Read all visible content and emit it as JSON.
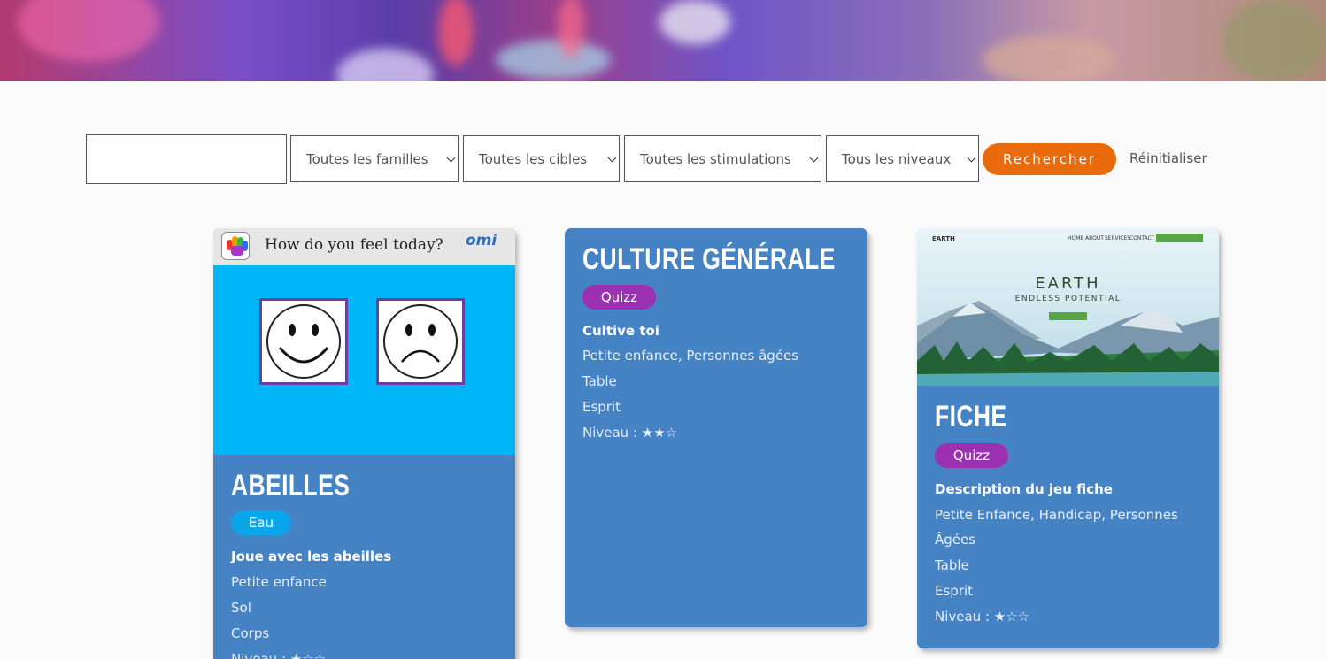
{
  "search": {
    "placeholder": ""
  },
  "filters": {
    "families": "Toutes les familles",
    "targets": "Toutes les cibles",
    "stimulations": "Toutes les stimulations",
    "levels": "Tous les niveaux"
  },
  "actions": {
    "search": "Rechercher",
    "reset": "Réinitialiser"
  },
  "colors": {
    "accent": "#ea6b0c",
    "card": "#4583c4",
    "tag_quizz": "#9b30b3",
    "tag_eau": "#0aa5ea"
  },
  "cards": [
    {
      "image": {
        "question": "How do you feel today?",
        "brand": "omi",
        "faces": [
          "happy-face-icon",
          "sad-face-icon"
        ]
      },
      "title": "Abeilles",
      "tag": "Eau",
      "description": "Joue avec les abeilles",
      "audience": "Petite enfance",
      "place": "Sol",
      "stimulation": "Corps",
      "level": "Niveau : ★☆☆",
      "level_value": 1,
      "level_max": 3
    },
    {
      "title": "Culture Générale",
      "tag": "Quizz",
      "description": "Cultive toi",
      "audience": "Petite enfance, Personnes âgées",
      "place": "Table",
      "stimulation": "Esprit",
      "level": "Niveau : ★★☆",
      "level_value": 2,
      "level_max": 3
    },
    {
      "image": {
        "logo": "EARTH",
        "nav": [
          "HOME",
          "ABOUT",
          "SERVICES",
          "CONTACT"
        ],
        "heading": "EARTH",
        "subheading": "ENDLESS POTENTIAL"
      },
      "title": "Fiche",
      "tag": "Quizz",
      "description": "Description du jeu fiche",
      "audience_line1": "Petite Enfance, Handicap, Personnes",
      "audience_line2": "Âgées",
      "place": "Table",
      "stimulation": "Esprit",
      "level": "Niveau : ★☆☆",
      "level_value": 1,
      "level_max": 3
    }
  ]
}
